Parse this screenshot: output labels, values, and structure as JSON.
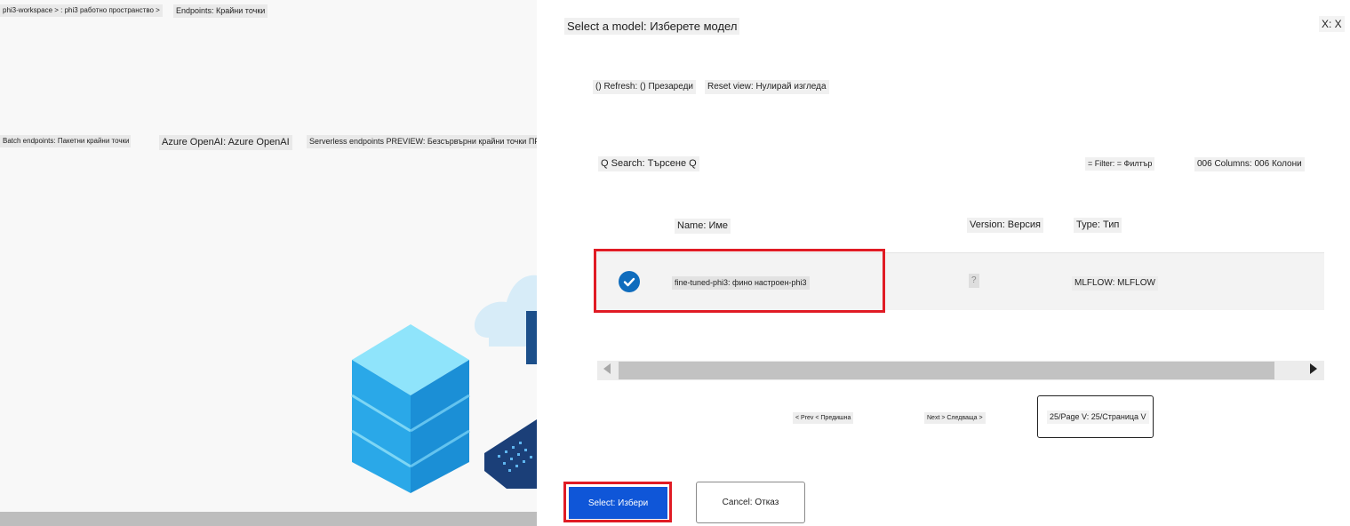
{
  "background_page": {
    "breadcrumb": {
      "workspace": "phi3-workspace > : phi3 работно пространство >",
      "current": "Endpoints: Крайни точки"
    },
    "tabs": [
      {
        "label": "Batch endpoints: Пакетни крайни точки"
      },
      {
        "label": "Azure OpenAI: Azure OpenAI"
      },
      {
        "label": "Serverless endpoints PREVIEW: Безсървърни крайни точки ПРЕДВ"
      }
    ]
  },
  "panel": {
    "title": "Select a model: Изберете модел",
    "close": "X: X",
    "toolbar": {
      "refresh": "() Refresh: () Презареди",
      "reset_view": "Reset view: Нулирай изгледа"
    },
    "search": "Q Search: Търсене Q",
    "filter": "= Filter: = Филтър",
    "columns": "006 Columns: 006 Колони",
    "table": {
      "headers": {
        "name": "Name: Име",
        "version": "Version: Версия",
        "type": "Type: Тип"
      },
      "rows": [
        {
          "name": "fine-tuned-phi3: фино настроен-phi3",
          "version": "?",
          "type": "MLFLOW: MLFLOW",
          "selected": true
        }
      ]
    },
    "pagination": {
      "prev": "< Prev < Предишна",
      "next": "Next > Следваща >",
      "page_size": "25/Page V: 25/Страница V"
    },
    "buttons": {
      "select": "Select: Избери",
      "cancel": "Cancel: Отказ"
    }
  },
  "colors": {
    "primary": "#0f56d8",
    "highlight_red": "#e01b24",
    "check_blue": "#0f6cbd"
  }
}
